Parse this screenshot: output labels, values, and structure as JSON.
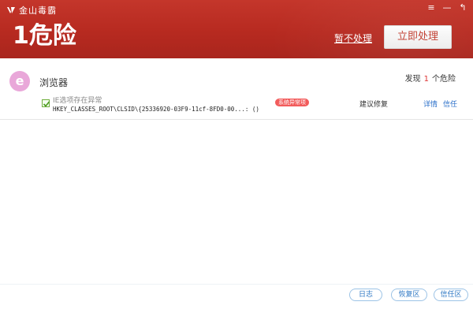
{
  "window": {
    "app_name": "金山毒霸",
    "controls": {
      "menu": "≡",
      "minimize": "—",
      "back": "↰"
    }
  },
  "header": {
    "risk_count_text": "1危险",
    "ignore_label": "暂不处理",
    "fix_button_label": "立即处理"
  },
  "section": {
    "icon_letter": "e",
    "title": "浏览器",
    "found_prefix": "发现",
    "found_count": "1",
    "found_suffix": "个危险"
  },
  "item": {
    "title": "IE选项存在异常",
    "path": "HKEY_CLASSES_ROOT\\CLSID\\{25336920-03F9-11cf-8FD0-00...: ()",
    "tag": "系统异常项",
    "action": "建议修复",
    "detail_link": "详情",
    "trust_link": "信任",
    "checked": true
  },
  "footer": {
    "log_label": "日志",
    "restore_label": "恢复区",
    "trust_zone_label": "信任区"
  },
  "colors": {
    "header_red": "#b72a20",
    "tag_red": "#f25c5c",
    "link_blue": "#2a6fc9",
    "ie_pink": "#e9a7d9"
  }
}
